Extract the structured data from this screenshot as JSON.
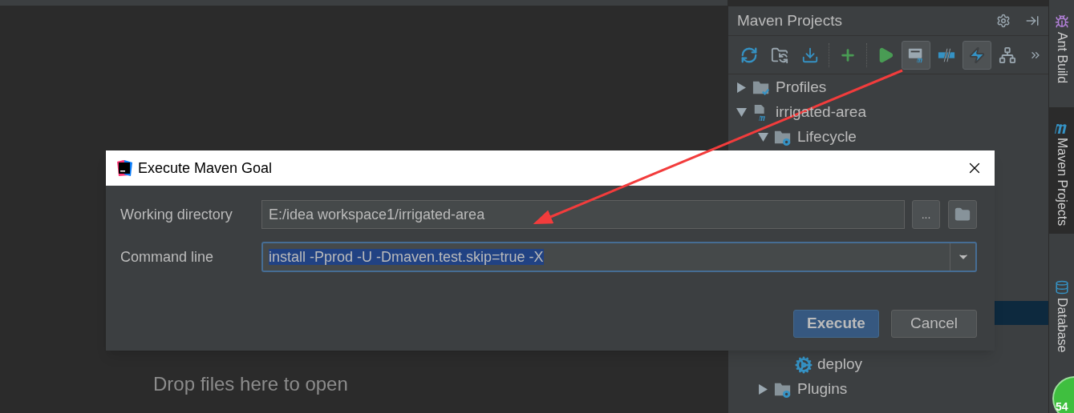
{
  "editor": {
    "hint": "Drop files here to open"
  },
  "maven_panel": {
    "title": "Maven Projects",
    "toolbar": [
      {
        "on": false
      },
      {
        "on": false
      },
      {
        "on": false
      },
      {
        "on": false
      },
      {
        "on": false
      },
      {
        "on": true
      },
      {
        "on": false
      },
      {
        "on": true
      },
      {
        "on": false
      }
    ],
    "tree": [
      {
        "label": "Profiles",
        "kind": "profiles",
        "expanded": false
      },
      {
        "label": "irrigated-area",
        "kind": "project",
        "expanded": true,
        "children": [
          {
            "label": "Lifecycle",
            "kind": "folder",
            "expanded": true,
            "children": [
              {
                "label": "deploy",
                "kind": "goal"
              }
            ]
          },
          {
            "label": "Plugins",
            "kind": "folder",
            "expanded": false
          }
        ]
      }
    ]
  },
  "side_stripe": [
    {
      "label": "Ant Build",
      "kind": "ant"
    },
    {
      "label": "Maven Projects",
      "kind": "maven",
      "selected": true
    },
    {
      "label": "Database",
      "kind": "database"
    }
  ],
  "floating_badge": {
    "label": "54"
  },
  "dialog": {
    "title": "Execute Maven Goal",
    "fields": [
      {
        "label": "Working directory",
        "value": "E:/idea workspace1/irrigated-area",
        "kind": "path",
        "browse_label": "..."
      },
      {
        "label": "Command line",
        "value": "install -Pprod -U -Dmaven.test.skip=true -X",
        "kind": "combo",
        "focused": true
      }
    ],
    "buttons": [
      {
        "label": "Execute",
        "default": true
      },
      {
        "label": "Cancel",
        "default": false
      }
    ]
  }
}
